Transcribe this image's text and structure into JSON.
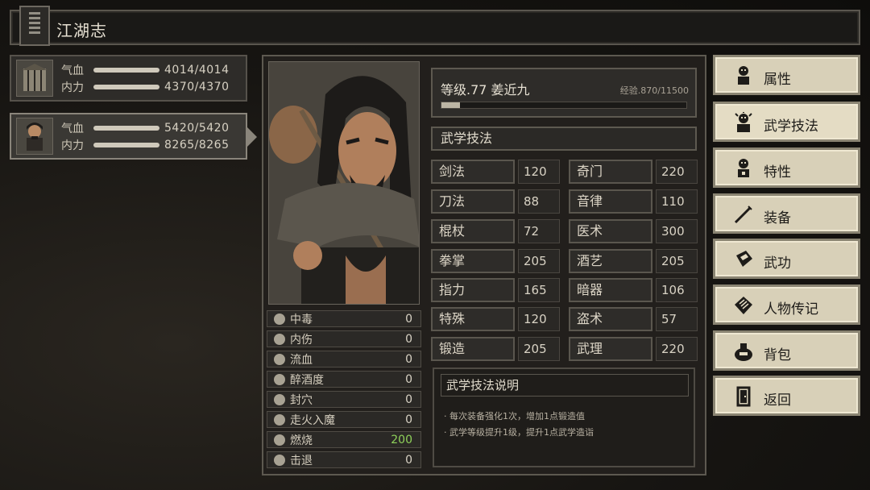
{
  "header": {
    "title": "江湖志",
    "icon": "journal-book-icon"
  },
  "party": [
    {
      "portrait_icon": "cage-portrait",
      "rows": [
        {
          "label": "气血",
          "value": "4014/4014"
        },
        {
          "label": "内力",
          "value": "4370/4370"
        }
      ]
    },
    {
      "portrait_icon": "hero-portrait",
      "rows": [
        {
          "label": "气血",
          "value": "5420/5420"
        },
        {
          "label": "内力",
          "value": "8265/8265"
        }
      ]
    }
  ],
  "character": {
    "level_line": "等级.77 姜近九",
    "exp_text": "经验.870/11500",
    "exp_fraction": 0.0757
  },
  "skills_header": "武学技法",
  "skills": [
    {
      "name": "剑法",
      "value": "120"
    },
    {
      "name": "奇门",
      "value": "220"
    },
    {
      "name": "刀法",
      "value": "88"
    },
    {
      "name": "音律",
      "value": "110"
    },
    {
      "name": "棍杖",
      "value": "72"
    },
    {
      "name": "医术",
      "value": "300"
    },
    {
      "name": "拳掌",
      "value": "205"
    },
    {
      "name": "酒艺",
      "value": "205"
    },
    {
      "name": "指力",
      "value": "165"
    },
    {
      "name": "暗器",
      "value": "106"
    },
    {
      "name": "特殊",
      "value": "120"
    },
    {
      "name": "盗术",
      "value": "57"
    },
    {
      "name": "锻造",
      "value": "205"
    },
    {
      "name": "武理",
      "value": "220"
    }
  ],
  "status": [
    {
      "name": "中毒",
      "value": "0",
      "icon": "skull-icon"
    },
    {
      "name": "内伤",
      "value": "0",
      "icon": "broken-heart-icon"
    },
    {
      "name": "流血",
      "value": "0",
      "icon": "blood-drop-icon"
    },
    {
      "name": "醉酒度",
      "value": "0",
      "icon": "drunk-face-icon"
    },
    {
      "name": "封穴",
      "value": "0",
      "icon": "acupoint-icon"
    },
    {
      "name": "走火入魔",
      "value": "0",
      "icon": "mad-face-icon"
    },
    {
      "name": "燃烧",
      "value": "200",
      "icon": "flame-icon",
      "highlight": "#8fd15a"
    },
    {
      "name": "击退",
      "value": "0",
      "icon": "knockback-icon"
    }
  ],
  "description": {
    "title": "武学技法说明",
    "lines": [
      "· 每次装备强化1次，增加1点锻造值",
      "· 武学等级提升1级，提升1点武学造诣"
    ]
  },
  "menu": [
    {
      "label": "属性",
      "icon": "person-icon"
    },
    {
      "label": "武学技法",
      "icon": "martial-person-icon",
      "active": true
    },
    {
      "label": "特性",
      "icon": "trait-person-icon"
    },
    {
      "label": "装备",
      "icon": "sword-icon"
    },
    {
      "label": "武功",
      "icon": "manual-book-icon"
    },
    {
      "label": "人物传记",
      "icon": "scroll-icon"
    },
    {
      "label": "背包",
      "icon": "bag-icon"
    },
    {
      "label": "返回",
      "icon": "door-icon"
    }
  ]
}
